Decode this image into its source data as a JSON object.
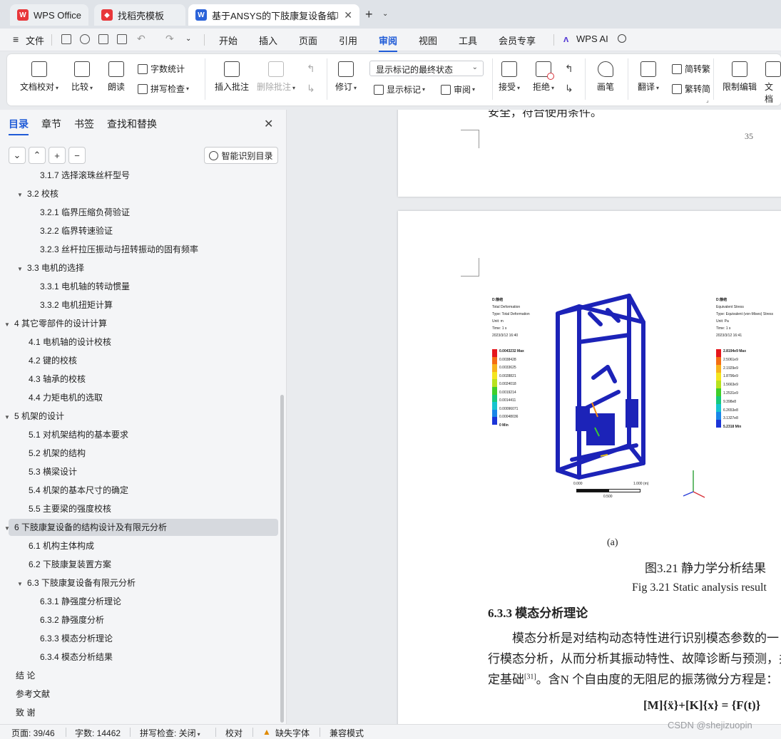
{
  "tabs": {
    "wps_office": "WPS Office",
    "find_template": "找稻壳模板",
    "document": "基于ANSYS的下肢康复设备结"
  },
  "menu": {
    "file": "文件",
    "items": [
      "开始",
      "插入",
      "页面",
      "引用",
      "审阅",
      "视图",
      "工具",
      "会员专享"
    ],
    "active": "审阅",
    "wps_ai": "WPS AI"
  },
  "ribbon": {
    "doc_proof": "文档校对",
    "compare": "比较",
    "read_aloud": "朗读",
    "word_count": "字数统计",
    "spell_check": "拼写检查",
    "insert_comment": "插入批注",
    "delete_comment": "删除批注",
    "track_changes": "修订",
    "display_select": "显示标记的最终状态",
    "show_markup": "显示标记",
    "review": "审阅",
    "accept": "接受",
    "reject": "拒绝",
    "pen": "画笔",
    "translate": "翻译",
    "to_traditional": "简转繁",
    "to_simplified": "繁转简",
    "restrict_edit": "限制编辑",
    "doc_permission": "文档"
  },
  "sidebar": {
    "tabs": [
      "目录",
      "章节",
      "书签",
      "查找和替换"
    ],
    "smart_toc": "智能识别目录",
    "toc": [
      {
        "text": "3.1.7 选择滚珠丝杆型号",
        "level": 3
      },
      {
        "text": "3.2 校核",
        "level": 2,
        "expand": "▼"
      },
      {
        "text": "3.2.1  临界压缩负荷验证",
        "level": 3
      },
      {
        "text": "3.2.2 临界转速验证",
        "level": 3
      },
      {
        "text": "3.2.3 丝杆拉压振动与扭转振动的固有频率",
        "level": 3
      },
      {
        "text": "3.3 电机的选择",
        "level": 2,
        "expand": "▼"
      },
      {
        "text": "3.3.1 电机轴的转动惯量",
        "level": 3
      },
      {
        "text": "3.3.2 电机扭矩计算",
        "level": 3
      },
      {
        "text": "4   其它零部件的设计计算",
        "level": 1,
        "expand": "▼"
      },
      {
        "text": "4.1 电机轴的设计校核",
        "level": 2
      },
      {
        "text": "4.2 键的校核",
        "level": 2
      },
      {
        "text": "4.3 轴承的校核",
        "level": 2
      },
      {
        "text": "4.4 力矩电机的选取",
        "level": 2
      },
      {
        "text": "5  机架的设计",
        "level": 1,
        "expand": "▼"
      },
      {
        "text": "5.1 对机架结构的基本要求",
        "level": 2
      },
      {
        "text": "5.2 机架的结构",
        "level": 2
      },
      {
        "text": "5.3 横梁设计",
        "level": 2
      },
      {
        "text": "5.4 机架的基本尺寸的确定",
        "level": 2
      },
      {
        "text": "5.5 主要梁的强度校核",
        "level": 2
      },
      {
        "text": "6  下肢康复设备的结构设计及有限元分析",
        "level": 1,
        "expand": "▼",
        "selected": true
      },
      {
        "text": "6.1 机构主体构成",
        "level": 2
      },
      {
        "text": "6.2 下肢康复装置方案",
        "level": 2
      },
      {
        "text": "6.3 下肢康复设备有限元分析",
        "level": 2,
        "expand": "▼"
      },
      {
        "text": "6.3.1 静强度分析理论",
        "level": 3
      },
      {
        "text": "6.3.2 静强度分析",
        "level": 3
      },
      {
        "text": "6.3.3 模态分析理论",
        "level": 3
      },
      {
        "text": "6.3.4 模态分析结果",
        "level": 3
      },
      {
        "text": "结   论",
        "level": 1
      },
      {
        "text": "参考文献",
        "level": 1
      },
      {
        "text": "致  谢",
        "level": 1
      }
    ]
  },
  "document": {
    "page1_partial_text": "安全，符合使用条件。",
    "page_number": "35",
    "left_legend": {
      "title": "D:静结",
      "lines": [
        "Total Deformation",
        "Type: Total Deformation",
        "Unit: m",
        "Time: 1 s",
        "2023/3/12 16:40"
      ],
      "max_label": "0.0043232 Max",
      "values": [
        "0.0038428",
        "0.0033625",
        "0.0028821",
        "0.0024018",
        "0.0019214",
        "0.0014411",
        "0.00096071",
        "0.00048036"
      ],
      "min_label": "0 Min",
      "colors": [
        "#e5161c",
        "#f46d13",
        "#f7b21a",
        "#f4e51e",
        "#b8e21e",
        "#3fcf29",
        "#17c97a",
        "#16c4cf",
        "#1a86e8",
        "#1b35d8"
      ]
    },
    "right_legend": {
      "title": "D:静结",
      "lines": [
        "Equivalent Stress",
        "Type: Equivalent (von-Mises) Stress",
        "Unit: Pa",
        "Time: 1 s",
        "2023/3/12 16:41"
      ],
      "max_label": "2.8194e9 Max",
      "values": [
        "2.5061e9",
        "2.1929e9",
        "1.8796e9",
        "1.5663e9",
        "1.2531e9",
        "9.398e8",
        "6.2653e8",
        "3.1327e8"
      ],
      "min_label": "5.2318 Min"
    },
    "scale_labels": [
      "0.000",
      "1.000 (m)",
      "0.500"
    ],
    "subcaption": "(a)",
    "figure_caption_cn": "图3.21   静力学分析结果",
    "figure_caption_en": "Fig 3.21  Static analysis result",
    "section_heading": "6.3.3 模态分析理论",
    "para_line1": "模态分析是对结构动态特性进行识别模态参数的一",
    "para_line2": "行模态分析，从而分析其振动特性、故障诊断与预测，并对",
    "para_line3_a": "定基础",
    "para_line3_ref": "[31]",
    "para_line3_b": "。含N 个自由度的无阻尼的振荡微分方程是：",
    "equation": "[M]{ẍ}+[K]{x} = {F(t)}"
  },
  "status": {
    "page": "页面: 39/46",
    "words": "字数: 14462",
    "spell": "拼写检查: 关闭",
    "proof": "校对",
    "missing_font": "缺失字体",
    "compat": "兼容模式",
    "watermark": "CSDN @shejizuopin"
  }
}
